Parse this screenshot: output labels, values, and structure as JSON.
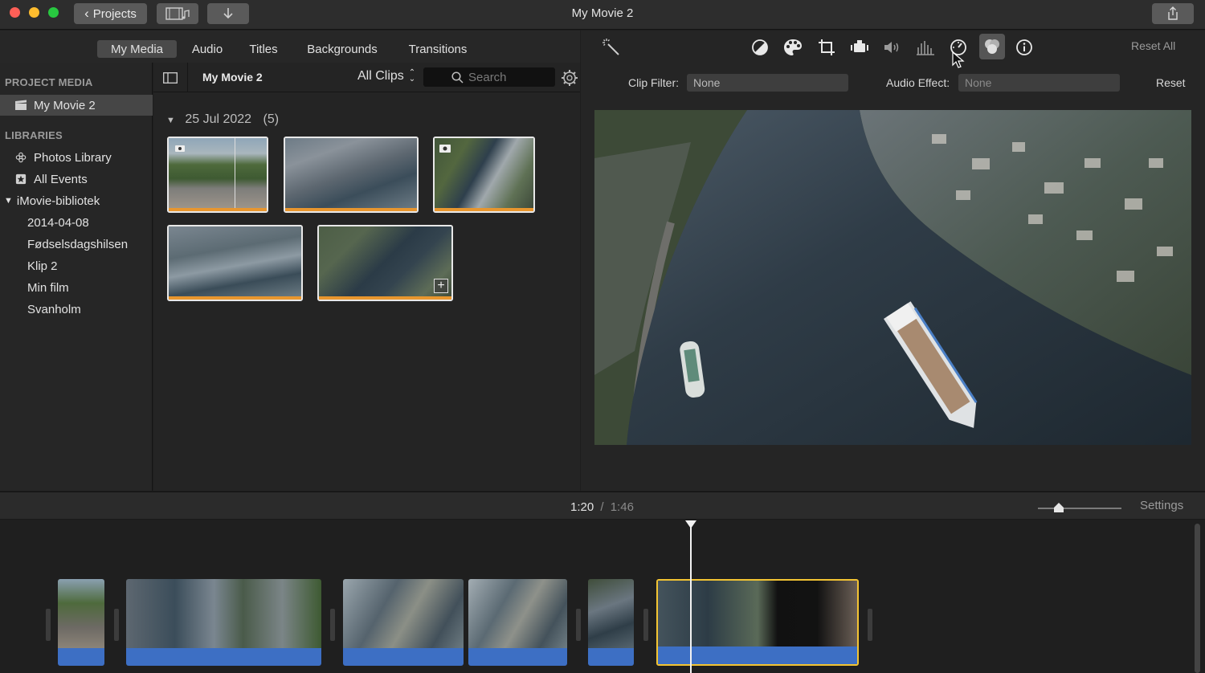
{
  "window": {
    "title": "My Movie 2",
    "projects_button": "Projects"
  },
  "browser_tabs": [
    {
      "label": "My Media",
      "active": true
    },
    {
      "label": "Audio",
      "active": false
    },
    {
      "label": "Titles",
      "active": false
    },
    {
      "label": "Backgrounds",
      "active": false
    },
    {
      "label": "Transitions",
      "active": false
    }
  ],
  "sidebar": {
    "project_media_header": "PROJECT MEDIA",
    "project_item": "My Movie 2",
    "libraries_header": "LIBRARIES",
    "libraries": [
      {
        "label": "Photos Library",
        "icon": "flower-icon"
      },
      {
        "label": "All Events",
        "icon": "star-icon"
      }
    ],
    "library_group": "iMovie-bibliotek",
    "events": [
      "2014-04-08",
      "Fødselsdagshilsen",
      "Klip 2",
      "Min film",
      "Svanholm"
    ]
  },
  "browser": {
    "title": "My Movie 2",
    "filter": "All Clips",
    "search_placeholder": "Search",
    "event_date": "25 Jul 2022",
    "event_count": "(5)"
  },
  "viewer": {
    "clip_filter_label": "Clip Filter:",
    "clip_filter_value": "None",
    "audio_effect_label": "Audio Effect:",
    "audio_effect_value": "None",
    "reset_all": "Reset All",
    "reset": "Reset",
    "adjust_icons": [
      "magic-wand-icon",
      "color-balance-icon",
      "palette-icon",
      "crop-icon",
      "camera-stabilization-icon",
      "volume-icon",
      "equalizer-icon",
      "speed-icon",
      "clip-filter-icon",
      "info-icon"
    ]
  },
  "timeline": {
    "current_time": "1:20",
    "separator": "/",
    "total_time": "1:46",
    "settings": "Settings",
    "zoom_level": 0.22
  },
  "colors": {
    "accent_orange": "#e8962e",
    "audio_blue": "#3d6fc4",
    "selection_yellow": "#f3c433"
  }
}
